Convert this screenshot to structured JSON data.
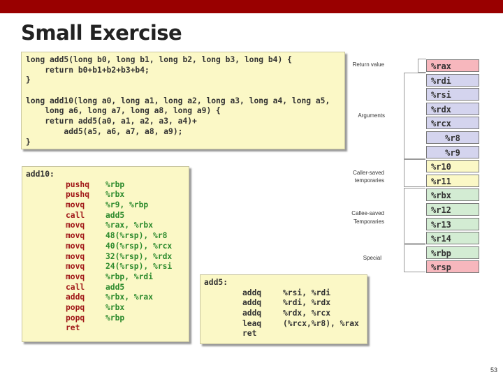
{
  "slide": {
    "title": "Small Exercise",
    "page_number": "53"
  },
  "c_code": {
    "lines": [
      "long add5(long b0, long b1, long b2, long b3, long b4) {",
      "    return b0+b1+b2+b3+b4;",
      "}",
      "",
      "long add10(long a0, long a1, long a2, long a3, long a4, long a5,",
      "    long a6, long a7, long a8, long a9) {",
      "    return add5(a0, a1, a2, a3, a4)+",
      "        add5(a5, a6, a7, a8, a9);",
      "}"
    ]
  },
  "add10_asm": {
    "label": "add10:",
    "instructions": [
      {
        "op": "pushq",
        "args": "%rbp"
      },
      {
        "op": "pushq",
        "args": "%rbx"
      },
      {
        "op": "movq",
        "args": "%r9, %rbp"
      },
      {
        "op": "call",
        "args": "add5"
      },
      {
        "op": "movq",
        "args": "%rax, %rbx"
      },
      {
        "op": "movq",
        "args": "48(%rsp), %r8"
      },
      {
        "op": "movq",
        "args": "40(%rsp), %rcx"
      },
      {
        "op": "movq",
        "args": "32(%rsp), %rdx"
      },
      {
        "op": "movq",
        "args": "24(%rsp), %rsi"
      },
      {
        "op": "movq",
        "args": "%rbp, %rdi"
      },
      {
        "op": "call",
        "args": "add5"
      },
      {
        "op": "addq",
        "args": "%rbx, %rax"
      },
      {
        "op": "popq",
        "args": "%rbx"
      },
      {
        "op": "popq",
        "args": "%rbp"
      },
      {
        "op": "ret",
        "args": ""
      }
    ]
  },
  "add5_asm": {
    "label": "add5:",
    "instructions": [
      {
        "op": "addq",
        "args": "%rsi, %rdi"
      },
      {
        "op": "addq",
        "args": "%rdi, %rdx"
      },
      {
        "op": "addq",
        "args": "%rdx, %rcx"
      },
      {
        "op": "leaq",
        "args": "(%rcx,%r8), %rax"
      },
      {
        "op": "ret",
        "args": ""
      }
    ]
  },
  "registers": {
    "labels": {
      "return_value": "Return value",
      "arguments": "Arguments",
      "caller_saved_1": "Caller-saved",
      "caller_saved_2": "temporaries",
      "callee_saved_1": "Callee-saved",
      "callee_saved_2": "Temporaries",
      "special": "Special"
    },
    "list": [
      {
        "name": "%rax",
        "group": "return",
        "color": "#f7b7bd"
      },
      {
        "name": "%rdi",
        "group": "arguments",
        "color": "#d4d4ee"
      },
      {
        "name": "%rsi",
        "group": "arguments",
        "color": "#d4d4ee"
      },
      {
        "name": "%rdx",
        "group": "arguments",
        "color": "#d4d4ee"
      },
      {
        "name": "%rcx",
        "group": "arguments",
        "color": "#d4d4ee"
      },
      {
        "name": "%r8",
        "group": "arguments",
        "color": "#d4d4ee"
      },
      {
        "name": "%r9",
        "group": "arguments",
        "color": "#d4d4ee"
      },
      {
        "name": "%r10",
        "group": "caller_saved",
        "color": "#fbf8c6"
      },
      {
        "name": "%r11",
        "group": "caller_saved",
        "color": "#fbf8c6"
      },
      {
        "name": "%rbx",
        "group": "callee_saved",
        "color": "#d3ecd3"
      },
      {
        "name": "%r12",
        "group": "callee_saved",
        "color": "#d3ecd3"
      },
      {
        "name": "%r13",
        "group": "callee_saved",
        "color": "#d3ecd3"
      },
      {
        "name": "%r14",
        "group": "callee_saved",
        "color": "#d3ecd3"
      },
      {
        "name": "%rbp",
        "group": "special",
        "color": "#d3ecd3"
      },
      {
        "name": "%rsp",
        "group": "special",
        "color": "#f7b7bd"
      }
    ]
  }
}
